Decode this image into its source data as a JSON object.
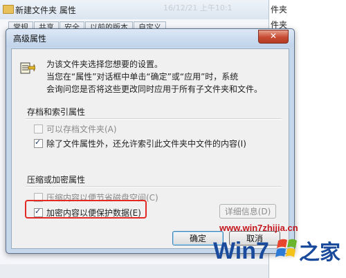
{
  "background_window": {
    "title": "新建文件夹 属性",
    "date_text": "16/12/21 上午10:1",
    "tabs": [
      "常规",
      "共享",
      "安全",
      "以前的版本",
      "自定义"
    ],
    "right_pane_lines": [
      "件夹",
      "件夹"
    ]
  },
  "dialog": {
    "title": "高级属性",
    "close_symbol": "✕",
    "intro_lines": [
      "为该文件夹选择您想要的设置。",
      "当您在“属性”对话框中单击“确定”或“应用”时，系统",
      "会询问您是否将这些更改同时应用于所有子文件夹和文件。"
    ],
    "archive_group": {
      "label": "存档和索引属性",
      "options": [
        {
          "label": "可以存档文件夹(A)",
          "checked": false,
          "enabled": false
        },
        {
          "label": "除了文件属性外，还允许索引此文件夹中文件的内容(I)",
          "checked": true,
          "enabled": true
        }
      ]
    },
    "compress_group": {
      "label": "压缩或加密属性",
      "options": [
        {
          "label": "压缩内容以便节省磁盘空间(C)",
          "checked": false,
          "enabled": false
        },
        {
          "label": "加密内容以便保护数据(E)",
          "checked": true,
          "enabled": true
        }
      ],
      "details_button": "详细信息(D)"
    },
    "ok_button": "确定",
    "cancel_button": "取消"
  },
  "watermark": {
    "url": "www.win7zhijia.cn",
    "logo_text": "Win7",
    "logo_suffix": "之家"
  },
  "colors": {
    "highlight_box": "#e32a22",
    "watermark_red": "#c4161c",
    "watermark_blue": "#1a4a9c"
  }
}
